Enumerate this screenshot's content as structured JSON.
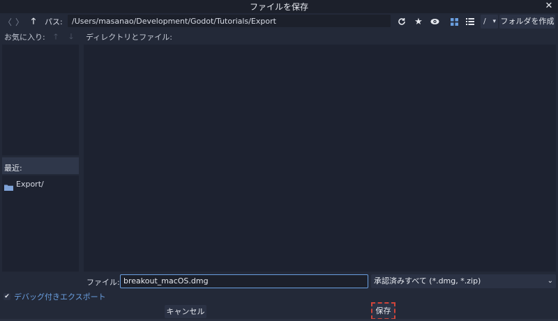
{
  "window": {
    "title": "ファイルを保存",
    "close_icon": "close-icon"
  },
  "toolbar": {
    "back_icon": "chevron-left-icon",
    "forward_icon": "chevron-right-icon",
    "up_icon": "arrow-up-icon",
    "path_label": "パス:",
    "path_value": "/Users/masanao/Development/Godot/Tutorials/Export",
    "refresh_icon": "refresh-icon",
    "favorite_icon": "star-icon",
    "hidden_toggle_icon": "eye-icon",
    "grid_view_icon": "grid-icon",
    "list_view_icon": "list-icon",
    "drive_value": "/",
    "make_folder_label": "フォルダを作成",
    "accent_color": "#6a9fe0"
  },
  "favorites": {
    "header": "お気に入り:",
    "move_up_icon": "arrow-up-icon",
    "move_down_icon": "arrow-down-icon",
    "items": []
  },
  "recent": {
    "header": "最近:",
    "items": [
      {
        "label": "Export/",
        "icon": "folder-icon"
      }
    ]
  },
  "files": {
    "header": "ディレクトリとファイル:",
    "items": []
  },
  "filename": {
    "label": "ファイル:",
    "value": "breakout_macOS.dmg"
  },
  "filter": {
    "selected": "承認済みすべて (*.dmg, *.zip)"
  },
  "debug_export": {
    "label": "デバッグ付きエクスポート",
    "checked": true
  },
  "buttons": {
    "cancel": "キャンセル",
    "save": "保存"
  }
}
